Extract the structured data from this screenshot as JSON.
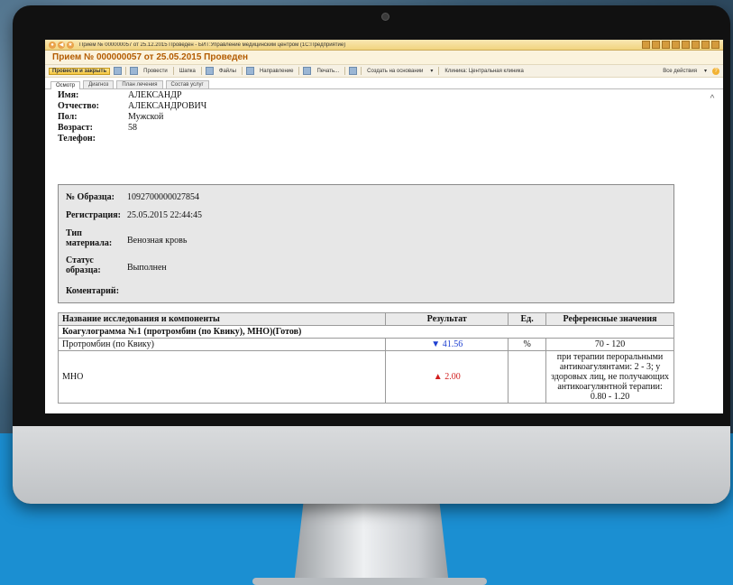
{
  "window": {
    "title": "Прием № 000000057 от 25.12.2015 Проведен - БИТ:Управление медицинским центром  (1С:Предприятие)"
  },
  "document": {
    "title": "Прием № 000000057 от 25.05.2015 Проведен"
  },
  "toolbar": {
    "post_close": "Провести и закрыть",
    "post": "Провести",
    "header": "Шапка",
    "files": "Файлы",
    "direction": "Направление",
    "print": "Печать...",
    "create_based": "Создать на основании",
    "clinic": "Клиника: Центральная клиника",
    "all_actions": "Все действия"
  },
  "tabs": [
    "Осмотр",
    "Диагноз",
    "План лечения",
    "Состав услуг"
  ],
  "patient": {
    "name_label": "Имя:",
    "name": "АЛЕКСАНДР",
    "patronymic_label": "Отчество:",
    "patronymic": "АЛЕКСАНДРОВИЧ",
    "sex_label": "Пол:",
    "sex": "Мужской",
    "age_label": "Возраст:",
    "age": "58",
    "phone_label": "Телефон:",
    "phone": ""
  },
  "sample": {
    "number_label": "№ Образца:",
    "number": "1092700000027854",
    "reg_label": "Регистрация:",
    "reg": "25.05.2015 22:44:45",
    "material_label": "Тип материала:",
    "material": "Венозная кровь",
    "status_label": "Статус образца:",
    "status": "Выполнен",
    "comment_label": "Коментарий:",
    "comment": ""
  },
  "results": {
    "headers": [
      "Название исследования и компоненты",
      "Результат",
      "Ед.",
      "Референсные значения"
    ],
    "group": "Коагулограмма №1 (протромбин (по Квику), МНО)(Готов)",
    "rows": [
      {
        "name": "Протромбин (по Квику)",
        "result": "▼ 41.56",
        "unit": "%",
        "ref": "70 - 120"
      },
      {
        "name": "МНО",
        "result": "▲ 2.00",
        "unit": "",
        "ref": "при терапии пероральными антикоагулянтами: 2 - 3; у здоровых лиц, не получающих антикоагулянтной терапии: 0.80 - 1.20"
      }
    ]
  },
  "colors": {
    "title_orange": "#b35b00",
    "down_arrow": "#1d3fd1",
    "up_arrow": "#d11d1d"
  }
}
